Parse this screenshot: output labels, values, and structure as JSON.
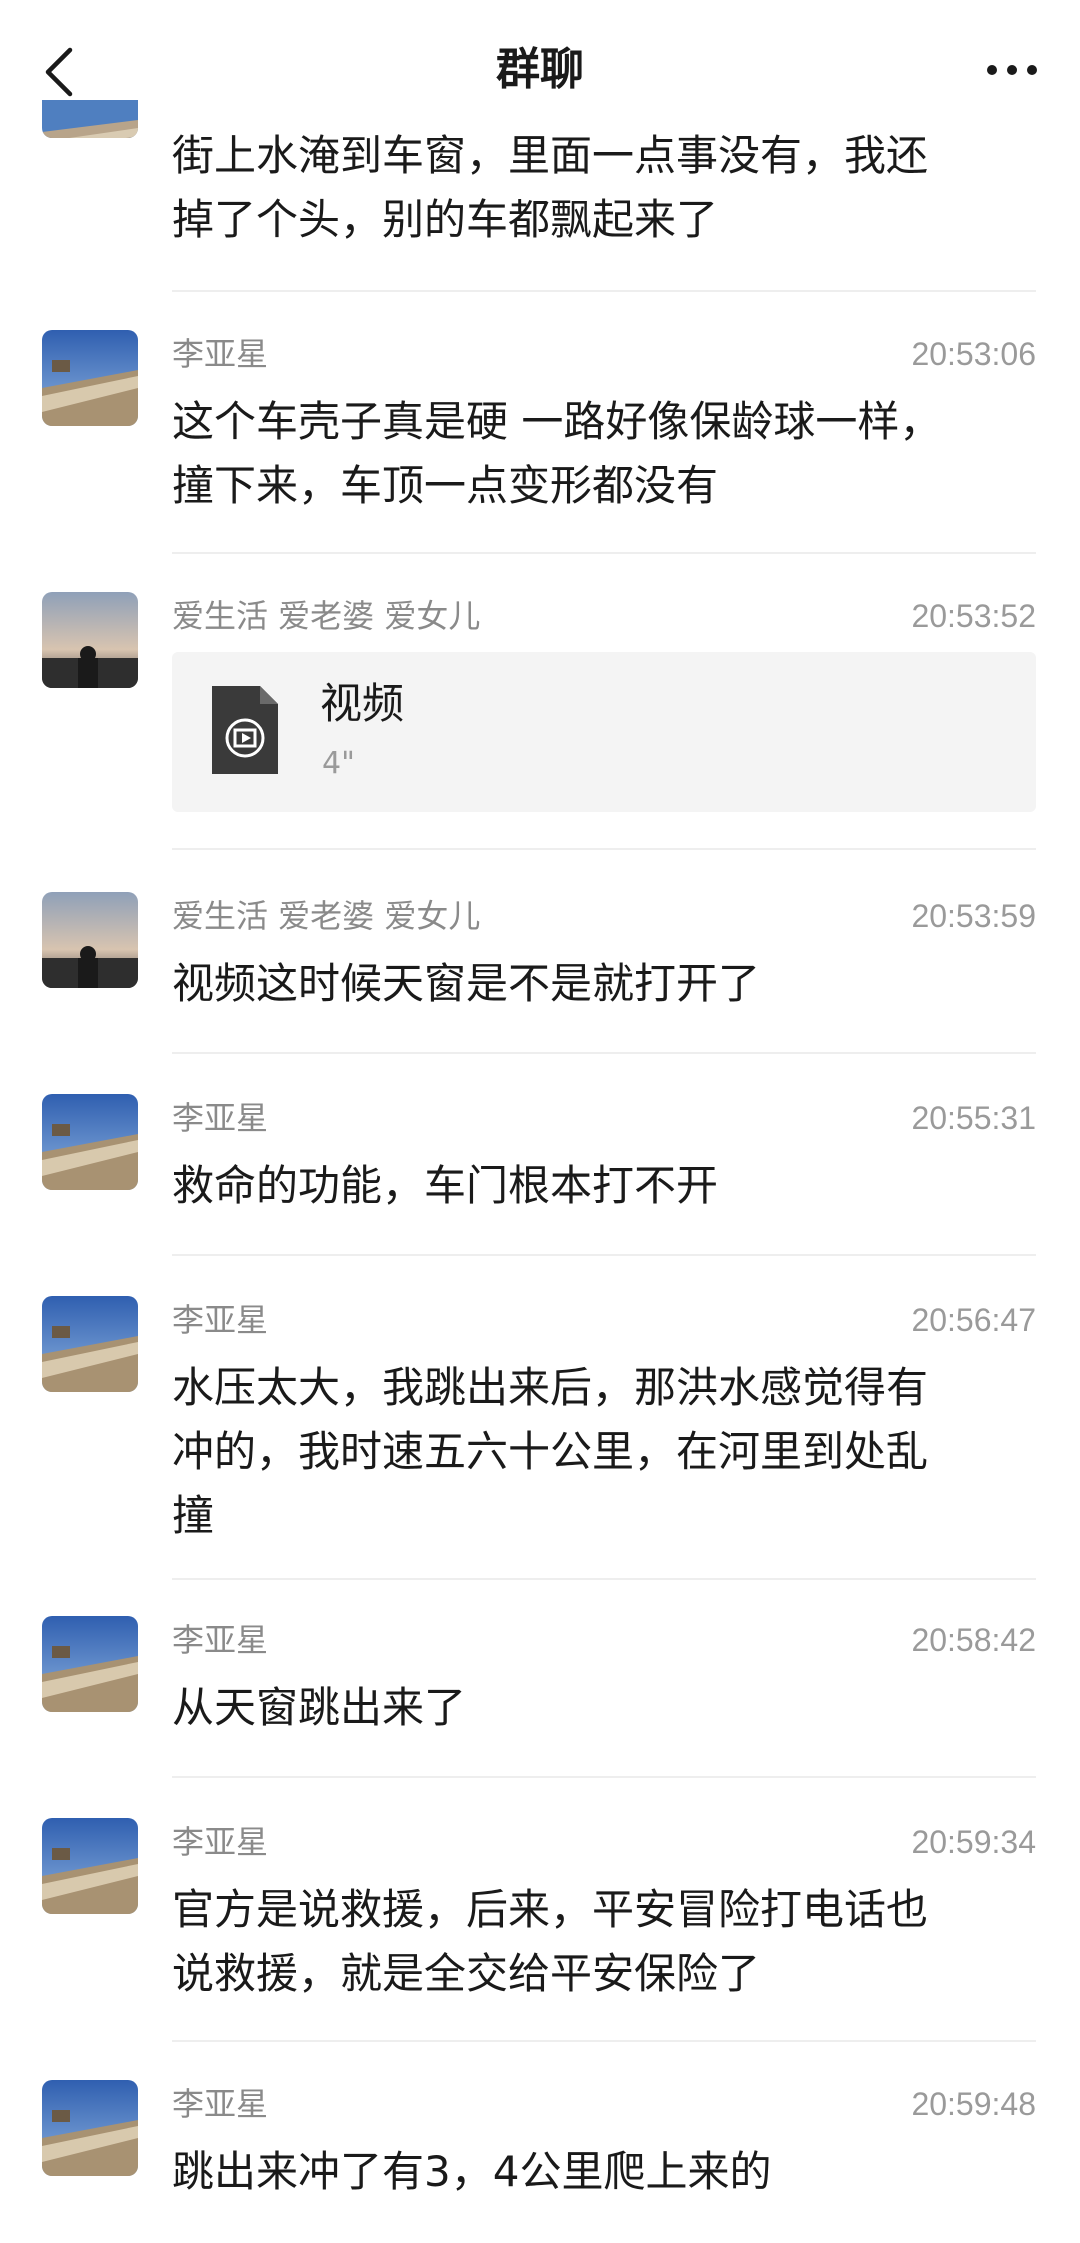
{
  "header": {
    "title": "群聊"
  },
  "messages": [
    {
      "sender": "",
      "time": "",
      "lines": [
        "街上水淹到车窗，里面一点事没有，我还",
        "掉了个头，别的车都飘起来了"
      ]
    },
    {
      "sender": "李亚星",
      "time": "20:53:06",
      "lines": [
        "这个车壳子真是硬 一路好像保龄球一样，",
        "撞下来，车顶一点变形都没有"
      ]
    },
    {
      "sender": "爱生活 爱老婆  爱女儿",
      "time": "20:53:52",
      "file": {
        "name": "视频",
        "duration": "4\""
      }
    },
    {
      "sender": "爱生活 爱老婆  爱女儿",
      "time": "20:53:59",
      "lines": [
        "视频这时候天窗是不是就打开了"
      ]
    },
    {
      "sender": "李亚星",
      "time": "20:55:31",
      "lines": [
        "救命的功能，车门根本打不开"
      ]
    },
    {
      "sender": "李亚星",
      "time": "20:56:47",
      "lines": [
        "水压太大，我跳出来后，那洪水感觉得有",
        "冲的，我时速五六十公里，在河里到处乱",
        "撞"
      ]
    },
    {
      "sender": "李亚星",
      "time": "20:58:42",
      "lines": [
        "从天窗跳出来了"
      ]
    },
    {
      "sender": "李亚星",
      "time": "20:59:34",
      "lines": [
        "官方是说救援，后来，平安冒险打电话也",
        "说救援，就是全交给平安保险了"
      ]
    },
    {
      "sender": "李亚星",
      "time": "20:59:48",
      "lines": [
        "跳出来冲了有3，4公里爬上来的"
      ]
    }
  ],
  "icons": {
    "back": "chevron-left-icon",
    "more": "more-horizontal-icon",
    "video_file": "video-file-icon"
  },
  "colors": {
    "secondary_text": "#8a8a8a",
    "file_bg": "#f4f4f4"
  }
}
